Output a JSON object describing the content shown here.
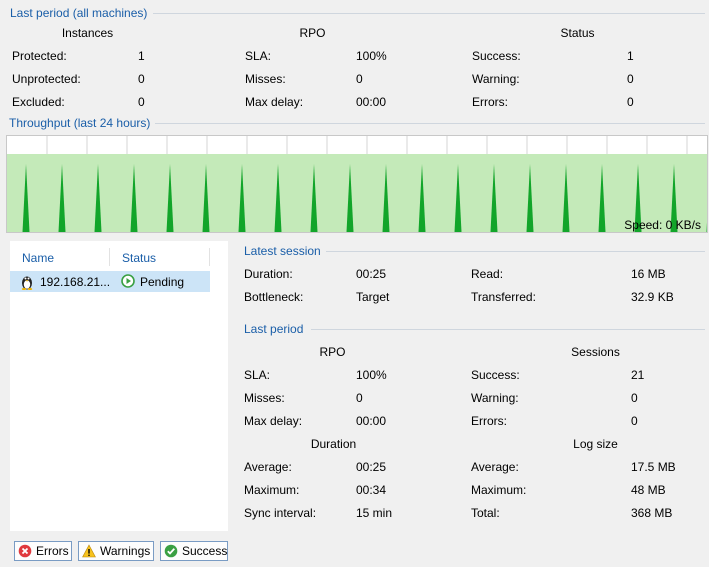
{
  "summary": {
    "title": "Last period (all machines)",
    "instances": {
      "header": "Instances",
      "rows": [
        {
          "label": "Protected:",
          "value": "1"
        },
        {
          "label": "Unprotected:",
          "value": "0"
        },
        {
          "label": "Excluded:",
          "value": "0"
        }
      ]
    },
    "rpo": {
      "header": "RPO",
      "rows": [
        {
          "label": "SLA:",
          "value": "100%"
        },
        {
          "label": "Misses:",
          "value": "0"
        },
        {
          "label": "Max delay:",
          "value": "00:00"
        }
      ]
    },
    "status": {
      "header": "Status",
      "rows": [
        {
          "label": "Success:",
          "value": "1"
        },
        {
          "label": "Warning:",
          "value": "0"
        },
        {
          "label": "Errors:",
          "value": "0"
        }
      ]
    }
  },
  "throughput": {
    "title": "Throughput (last 24 hours)",
    "speed_label": "Speed: 0 KB/s",
    "colors": {
      "fill": "#c4eab9",
      "spike": "#12a52a",
      "grid": "#d6d6d6"
    }
  },
  "list": {
    "col_name": "Name",
    "col_status": "Status",
    "rows": [
      {
        "name": "192.168.21...",
        "status": "Pending",
        "icon": "linux-penguin-icon"
      }
    ]
  },
  "latest_session": {
    "title": "Latest session",
    "rows_left": [
      {
        "label": "Duration:",
        "value": "00:25"
      },
      {
        "label": "Bottleneck:",
        "value": "Target"
      }
    ],
    "rows_right": [
      {
        "label": "Read:",
        "value": "16 MB"
      },
      {
        "label": "Transferred:",
        "value": "32.9 KB"
      }
    ]
  },
  "last_period": {
    "title": "Last period",
    "rpo": {
      "header": "RPO",
      "rows": [
        {
          "label": "SLA:",
          "value": "100%"
        },
        {
          "label": "Misses:",
          "value": "0"
        },
        {
          "label": "Max delay:",
          "value": "00:00"
        }
      ]
    },
    "sessions": {
      "header": "Sessions",
      "rows": [
        {
          "label": "Success:",
          "value": "21"
        },
        {
          "label": "Warning:",
          "value": "0"
        },
        {
          "label": "Errors:",
          "value": "0"
        }
      ]
    },
    "duration": {
      "header": "Duration",
      "rows": [
        {
          "label": "Average:",
          "value": "00:25"
        },
        {
          "label": "Maximum:",
          "value": "00:34"
        },
        {
          "label": "Sync interval:",
          "value": "15 min"
        }
      ]
    },
    "log_size": {
      "header": "Log size",
      "rows": [
        {
          "label": "Average:",
          "value": "17.5 MB"
        },
        {
          "label": "Maximum:",
          "value": "48 MB"
        },
        {
          "label": "Total:",
          "value": "368 MB"
        }
      ]
    }
  },
  "filters": {
    "errors_label": "Errors",
    "warnings_label": "Warnings",
    "success_label": "Success"
  }
}
